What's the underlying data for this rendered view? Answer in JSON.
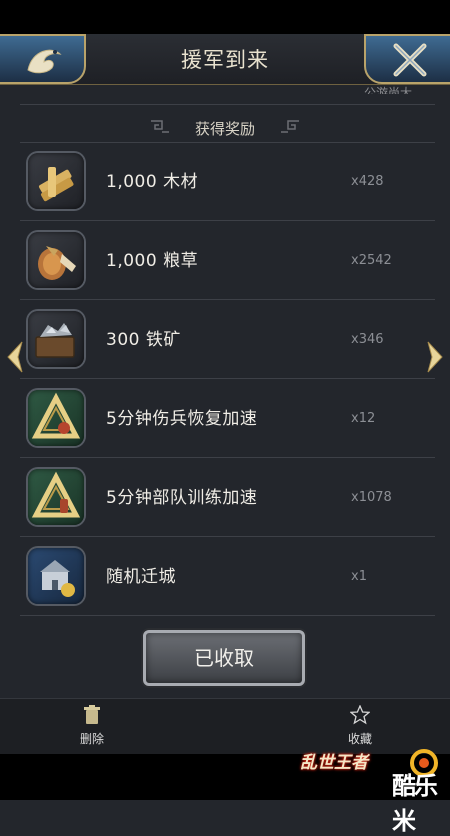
{
  "header": {
    "title": "援军到来"
  },
  "partial_text": "公游尚大",
  "section": {
    "title": "获得奖励"
  },
  "rewards": [
    {
      "name": "1,000 木材",
      "count": "x428",
      "icon": "wood-icon"
    },
    {
      "name": "1,000 粮草",
      "count": "x2542",
      "icon": "food-icon"
    },
    {
      "name": "300 铁矿",
      "count": "x346",
      "icon": "iron-ore-icon"
    },
    {
      "name": "5分钟伤兵恢复加速",
      "count": "x12",
      "icon": "heal-speedup-icon"
    },
    {
      "name": "5分钟部队训练加速",
      "count": "x1078",
      "icon": "train-speedup-icon"
    },
    {
      "name": "随机迁城",
      "count": "x1",
      "icon": "relocate-city-icon"
    }
  ],
  "collect_button": {
    "label": "已收取"
  },
  "bottom_bar": {
    "delete_label": "删除",
    "favorite_label": "收藏"
  },
  "watermark": {
    "game_logo": "乱世王者",
    "site_logo": "酷乐米"
  },
  "colors": {
    "accent_gold": "#b9a36a",
    "corner_blue": "#3f6b92",
    "panel_bg": "#23262c"
  }
}
